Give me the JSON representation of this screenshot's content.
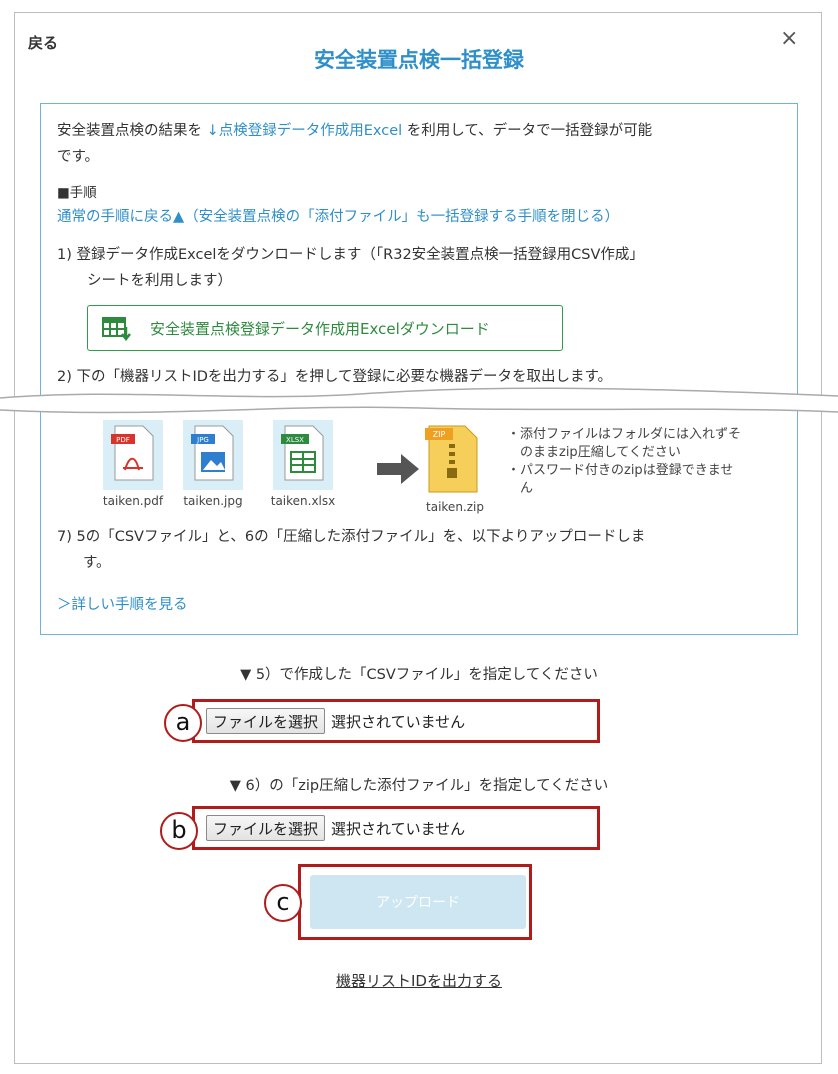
{
  "dialog": {
    "back_label": "戻る",
    "close_symbol": "×",
    "title": "安全装置点検一括登録"
  },
  "info": {
    "intro_line1_pre": "安全装置点検の結果を",
    "intro_link": "↓点検登録データ作成用Excel",
    "intro_line1_post": "を利用して、データで一括登録が可能",
    "intro_line2": "です。",
    "procedure_heading": "■手順",
    "return_link": "通常の手順に戻る▲",
    "return_note": "（安全装置点検の「添付ファイル」も一括登録する手順を閉じる）",
    "step1_line1": "1)  登録データ作成Excelをダウンロードします（「R32安全装置点検一括登録用CSV作成」",
    "step1_line2": "シートを利用します）",
    "excel_download_button": "安全装置点検登録データ作成用Excelダウンロード",
    "step2_line1": "2)  下の「機器リストIDを出力する」を押して登録に必要な機器データを取出します。",
    "files": [
      {
        "tag": "PDF",
        "caption": "taiken.pdf",
        "color": "#d9342b"
      },
      {
        "tag": "JPG",
        "caption": "taiken.jpg",
        "color": "#2f7fd0"
      },
      {
        "tag": "XLSX",
        "caption": "taiken.xlsx",
        "color": "#2e8b3e"
      }
    ],
    "zip": {
      "tag": "ZIP",
      "caption": "taiken.zip"
    },
    "notes": [
      "・添付ファイルはフォルダには入れずそ",
      "　のままzip圧縮してください",
      "・パスワード付きのzipは登録できませ",
      "　ん"
    ],
    "step7_line1": "7)  5の「CSVファイル」と、6の「圧縮した添付ファイル」を、以下よりアップロードしま",
    "step7_line2": "す。",
    "details_link": "＞詳しい手順を見る"
  },
  "form": {
    "csv_label": "▼ 5）で作成した「CSVファイル」を指定してください",
    "zip_label": "▼ 6）の「zip圧縮した添付ファイル」を指定してください",
    "choose_button": "ファイルを選択",
    "no_file": "選択されていません",
    "upload_button": "アップロード",
    "export_link": "機器リストIDを出力する"
  },
  "markers": {
    "a": "a",
    "b": "b",
    "c": "c"
  },
  "colors": {
    "accent": "#2f8fc9",
    "annotation_red": "#b01c1c",
    "upload_disabled": "#cde6f1",
    "excel_green": "#2e8b3e"
  }
}
